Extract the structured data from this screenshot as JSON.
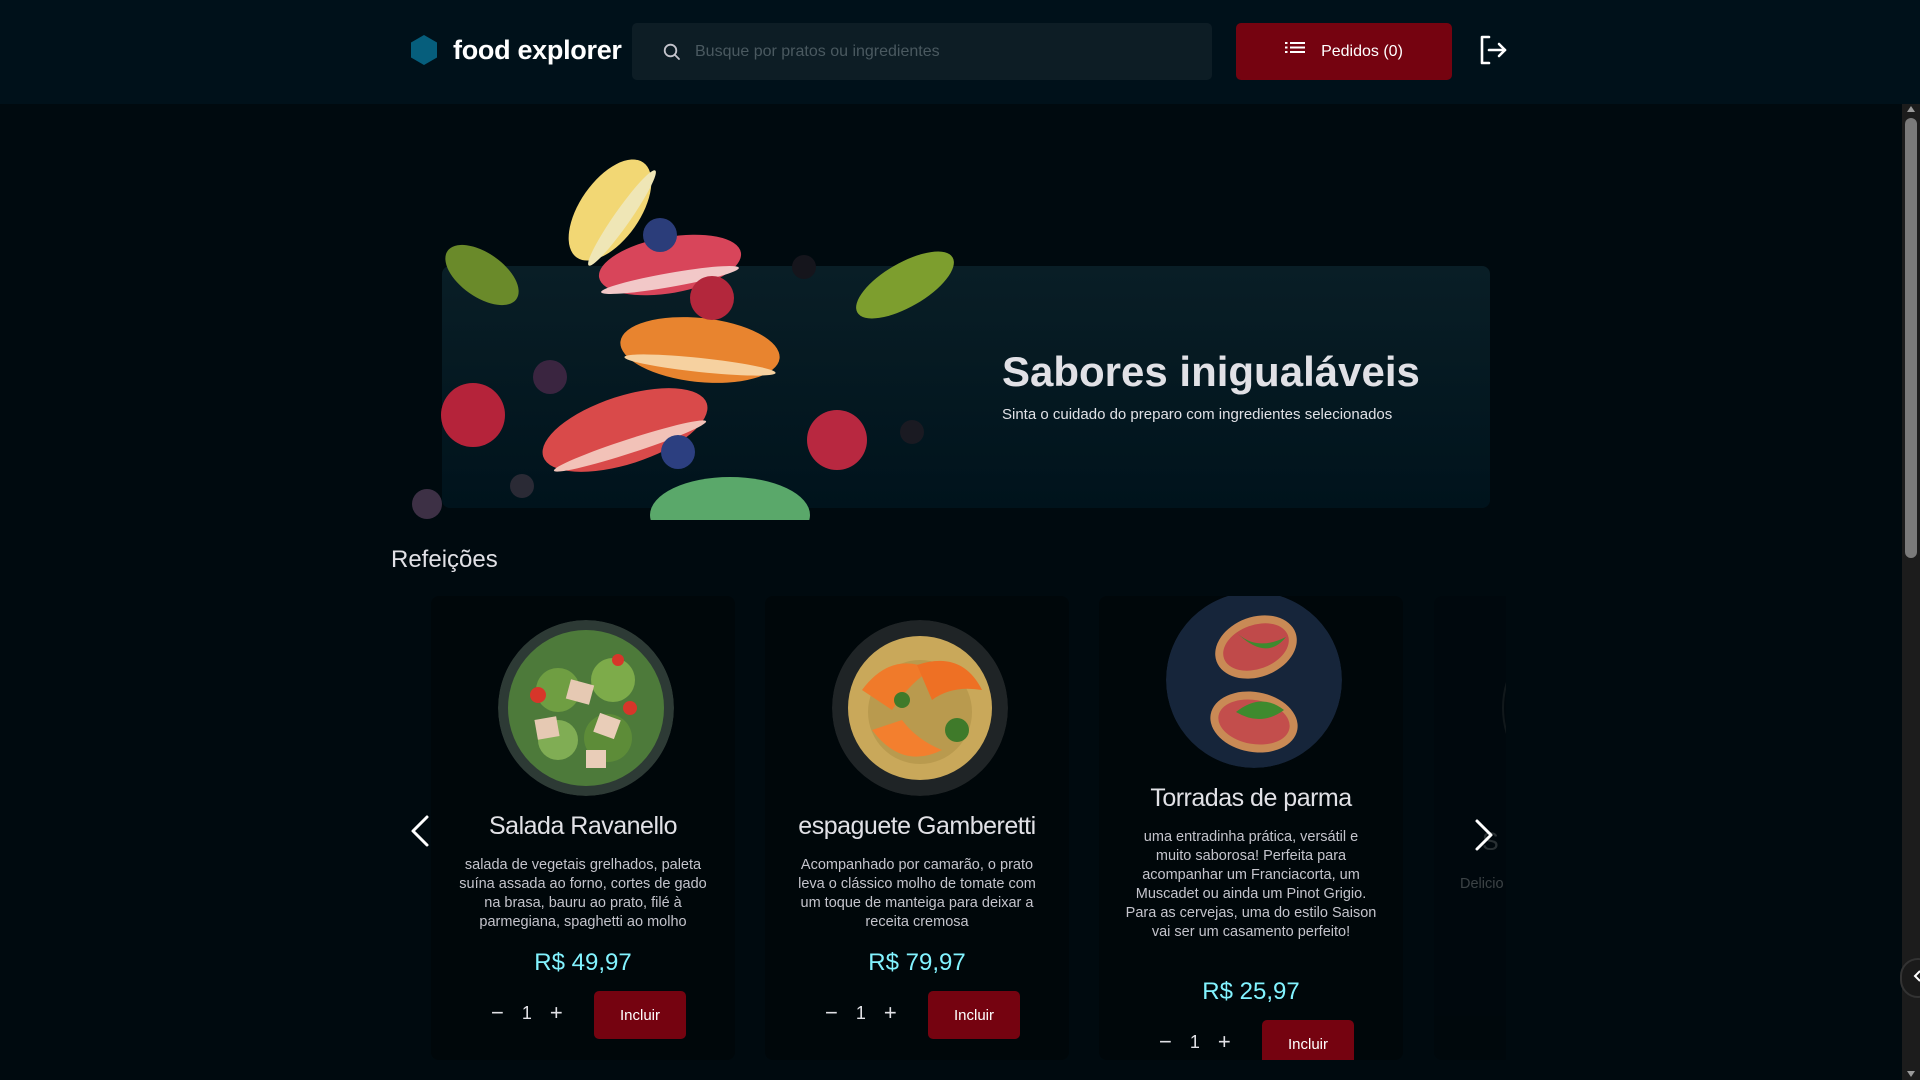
{
  "header": {
    "logo_text": "food explorer",
    "logo_icon": "hexagon-icon",
    "search_placeholder": "Busque por pratos ou ingredientes",
    "orders_label": "Pedidos (0)",
    "colors": {
      "background": "#00111a",
      "accent": "#750310",
      "logo": "#065e7c"
    }
  },
  "banner": {
    "title": "Sabores inigualáveis",
    "subtitle": "Sinta o cuidado do preparo com ingredientes selecionados"
  },
  "sections": [
    {
      "title": "Refeições",
      "cards": [
        {
          "name": "Salada Ravanello",
          "description": "salada de vegetais grelhados, paleta suína assada ao forno, cortes de gado na brasa, bauru ao prato, filé à parmegiana, spaghetti ao molho",
          "price": "R$ 49,97",
          "quantity": "1",
          "add_label": "Incluir"
        },
        {
          "name": "espaguete Gamberetti",
          "description": "Acompanhado por camarão, o prato leva o clássico molho de tomate com um toque de manteiga para deixar a receita cremosa",
          "price": "R$ 79,97",
          "quantity": "1",
          "add_label": "Incluir"
        },
        {
          "name": "Torradas de parma",
          "description": "uma entradinha prática, versátil e muito saborosa! Perfeita para acompanhar um Franciacorta, um Muscadet ou ainda um Pinot Grigio. Para as cervejas, uma do estilo Saison vai ser um casamento perfeito!",
          "price": "R$ 25,97",
          "quantity": "1",
          "add_label": "Incluir"
        },
        {
          "name": "S",
          "description": "Delicio"
        }
      ]
    }
  ],
  "colors": {
    "price": "#82f3ff",
    "page_bg": "#000a0f",
    "card_bg": "#00070a"
  }
}
